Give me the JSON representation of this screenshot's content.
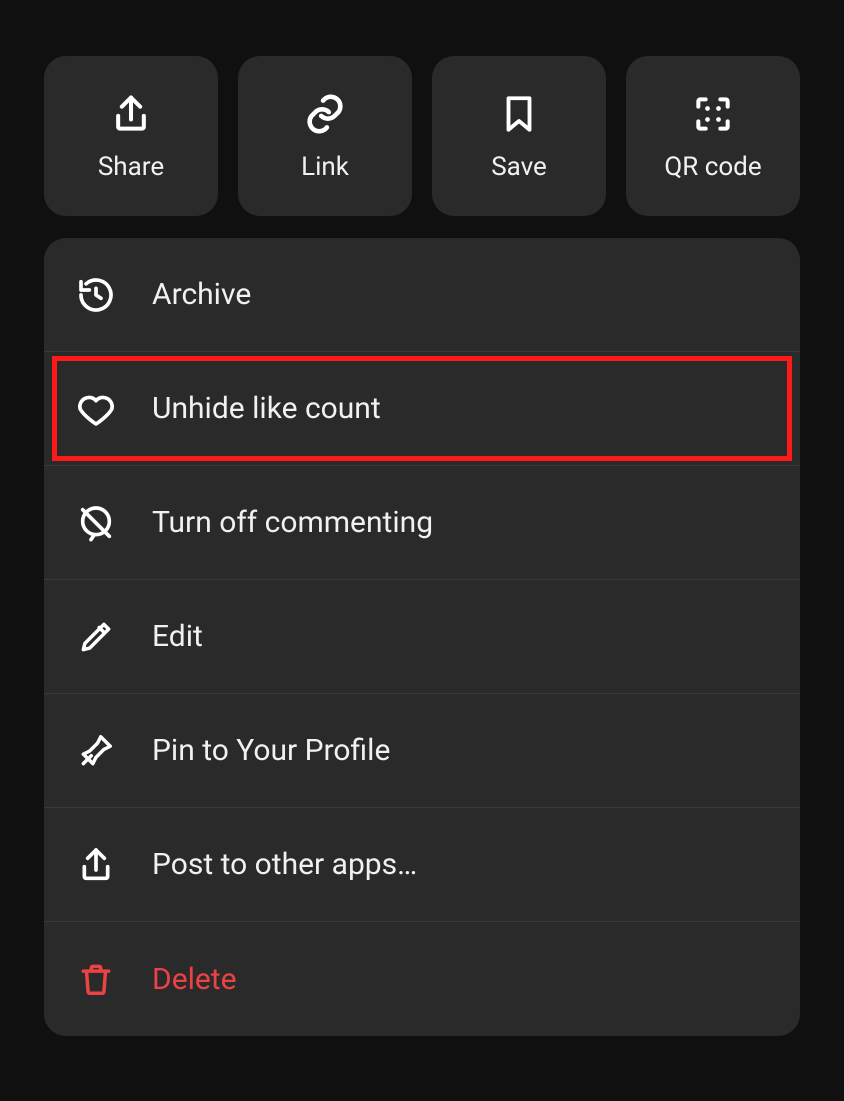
{
  "top": [
    {
      "label": "Share",
      "icon": "share-icon"
    },
    {
      "label": "Link",
      "icon": "link-icon"
    },
    {
      "label": "Save",
      "icon": "bookmark-icon"
    },
    {
      "label": "QR code",
      "icon": "qr-icon"
    }
  ],
  "menu": [
    {
      "label": "Archive",
      "icon": "history-icon",
      "danger": false,
      "highlight": false
    },
    {
      "label": "Unhide like count",
      "icon": "heart-icon",
      "danger": false,
      "highlight": true
    },
    {
      "label": "Turn off commenting",
      "icon": "comment-off-icon",
      "danger": false,
      "highlight": false
    },
    {
      "label": "Edit",
      "icon": "pencil-icon",
      "danger": false,
      "highlight": false
    },
    {
      "label": "Pin to Your Profile",
      "icon": "pin-icon",
      "danger": false,
      "highlight": false
    },
    {
      "label": "Post to other apps…",
      "icon": "share-icon",
      "danger": false,
      "highlight": false
    },
    {
      "label": "Delete",
      "icon": "trash-icon",
      "danger": true,
      "highlight": false
    }
  ]
}
